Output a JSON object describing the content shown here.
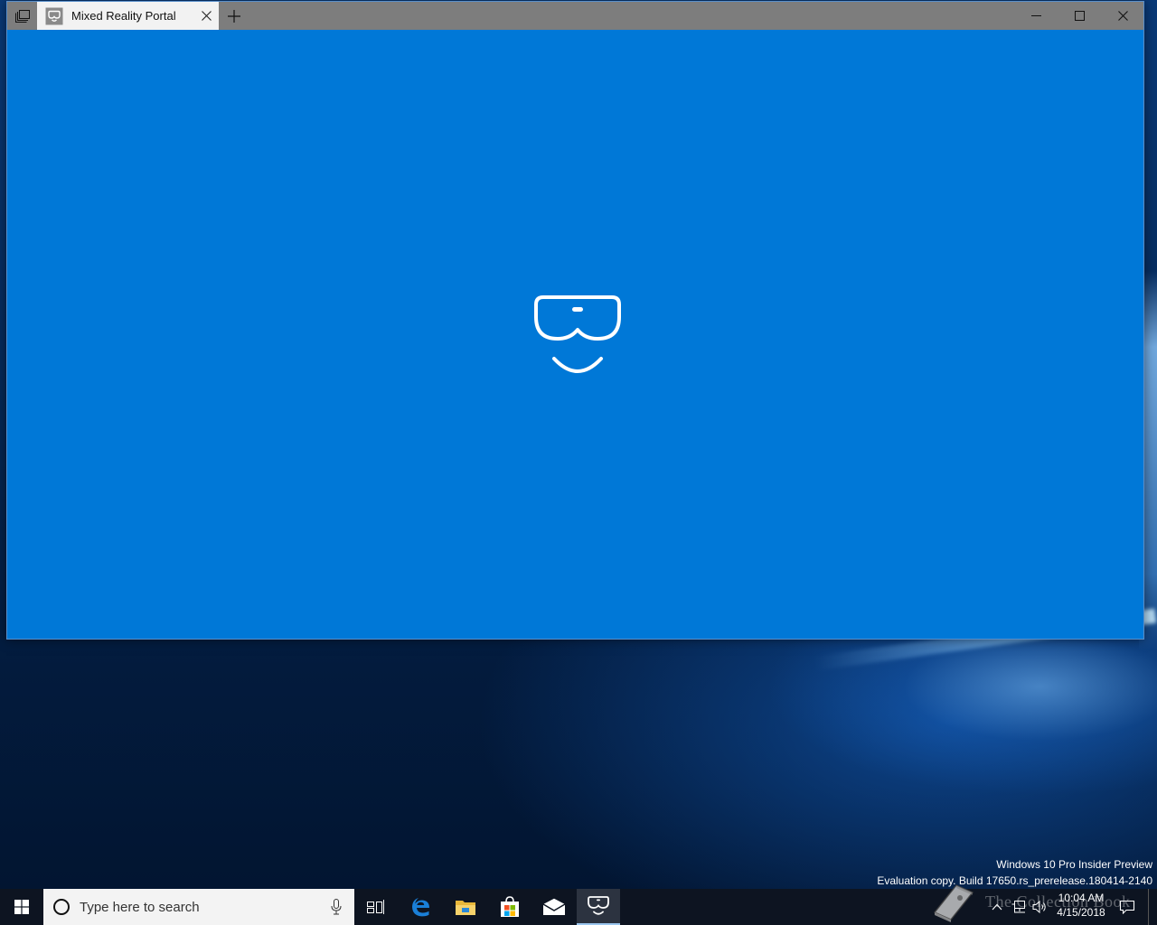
{
  "window": {
    "tab_title": "Mixed Reality Portal",
    "accent_color": "#0078d7",
    "titlebar_color": "#7d7d7d"
  },
  "icons": {
    "tab_list": "tab-list-icon",
    "app": "mixed-reality-headset-icon",
    "close_tab": "close-icon",
    "new_tab": "plus-icon",
    "minimize": "minimize-icon",
    "maximize": "maximize-icon",
    "close": "close-icon"
  },
  "watermark": {
    "line1": "Windows 10 Pro Insider Preview",
    "line2": "Evaluation copy. Build 17650.rs_prerelease.180414-2140"
  },
  "taskbar": {
    "search_placeholder": "Type here to search",
    "apps": [
      "task-view",
      "edge",
      "file-explorer",
      "store",
      "mail",
      "mixed-reality-portal"
    ],
    "active_app": "mixed-reality-portal",
    "clock_time": "10:04 AM",
    "clock_date": "4/15/2018"
  },
  "overlay": {
    "text": "The Collection Book"
  }
}
